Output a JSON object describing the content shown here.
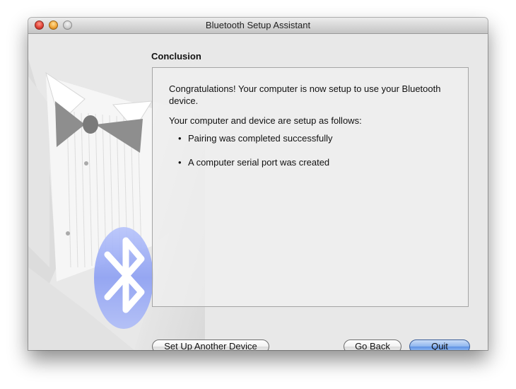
{
  "window": {
    "title": "Bluetooth Setup Assistant"
  },
  "section": {
    "heading": "Conclusion"
  },
  "panel": {
    "message": "Congratulations! Your computer is now setup to use your Bluetooth device.",
    "intro": "Your computer and device are setup as follows:",
    "bullets": [
      "Pairing was completed successfully",
      "A computer serial port was created"
    ],
    "bullet_glyph": "•"
  },
  "buttons": {
    "setup_another": "Set Up Another Device",
    "go_back": "Go Back",
    "quit": "Quit"
  },
  "icons": {
    "close": "close-window-icon",
    "minimize": "minimize-window-icon",
    "zoom": "zoom-window-icon",
    "artwork": "tuxedo-bluetooth-artwork"
  },
  "colors": {
    "bluetooth_logo": "#7a8ff0",
    "default_button": "#5f92e4"
  }
}
